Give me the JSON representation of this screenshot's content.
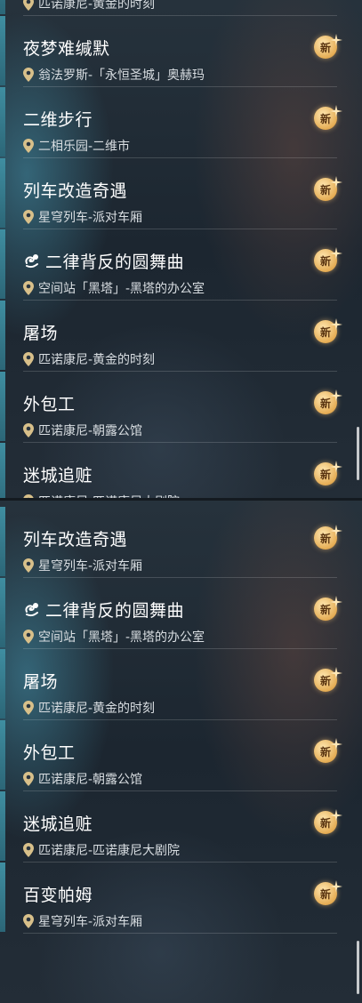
{
  "top_list": [
    {
      "title": "",
      "location": "匹诺康尼-黄金的时刻",
      "badge": "新",
      "special": false
    },
    {
      "title": "夜梦难缄默",
      "location": "翁法罗斯-「永恒圣城」奥赫玛",
      "badge": "新",
      "special": false
    },
    {
      "title": "二维步行",
      "location": "二相乐园-二维市",
      "badge": "新",
      "special": false
    },
    {
      "title": "列车改造奇遇",
      "location": "星穹列车-派对车厢",
      "badge": "新",
      "special": false
    },
    {
      "title": "二律背反的圆舞曲",
      "location": "空间站「黑塔」-黑塔的办公室",
      "badge": "新",
      "special": true
    },
    {
      "title": "屠场",
      "location": "匹诺康尼-黄金的时刻",
      "badge": "新",
      "special": false
    },
    {
      "title": "外包工",
      "location": "匹诺康尼-朝露公馆",
      "badge": "新",
      "special": false
    },
    {
      "title": "迷城追赃",
      "location": "匹诺康尼-匹诺康尼大剧院",
      "badge": "新",
      "special": false
    }
  ],
  "bottom_list": [
    {
      "title": "列车改造奇遇",
      "location": "星穹列车-派对车厢",
      "badge": "新",
      "special": false
    },
    {
      "title": "二律背反的圆舞曲",
      "location": "空间站「黑塔」-黑塔的办公室",
      "badge": "新",
      "special": true
    },
    {
      "title": "屠场",
      "location": "匹诺康尼-黄金的时刻",
      "badge": "新",
      "special": false
    },
    {
      "title": "外包工",
      "location": "匹诺康尼-朝露公馆",
      "badge": "新",
      "special": false
    },
    {
      "title": "迷城追赃",
      "location": "匹诺康尼-匹诺康尼大剧院",
      "badge": "新",
      "special": false
    },
    {
      "title": "百变帕姆",
      "location": "星穹列车-派对车厢",
      "badge": "新",
      "special": false
    }
  ],
  "icons": {
    "location": "map-pin-icon",
    "badge": "new-badge-icon",
    "special": "quest-icon"
  },
  "colors": {
    "accent": "#3f8ea1",
    "badge": "#e5ad55",
    "pin": "#d8c08a",
    "text": "#ffffff"
  }
}
